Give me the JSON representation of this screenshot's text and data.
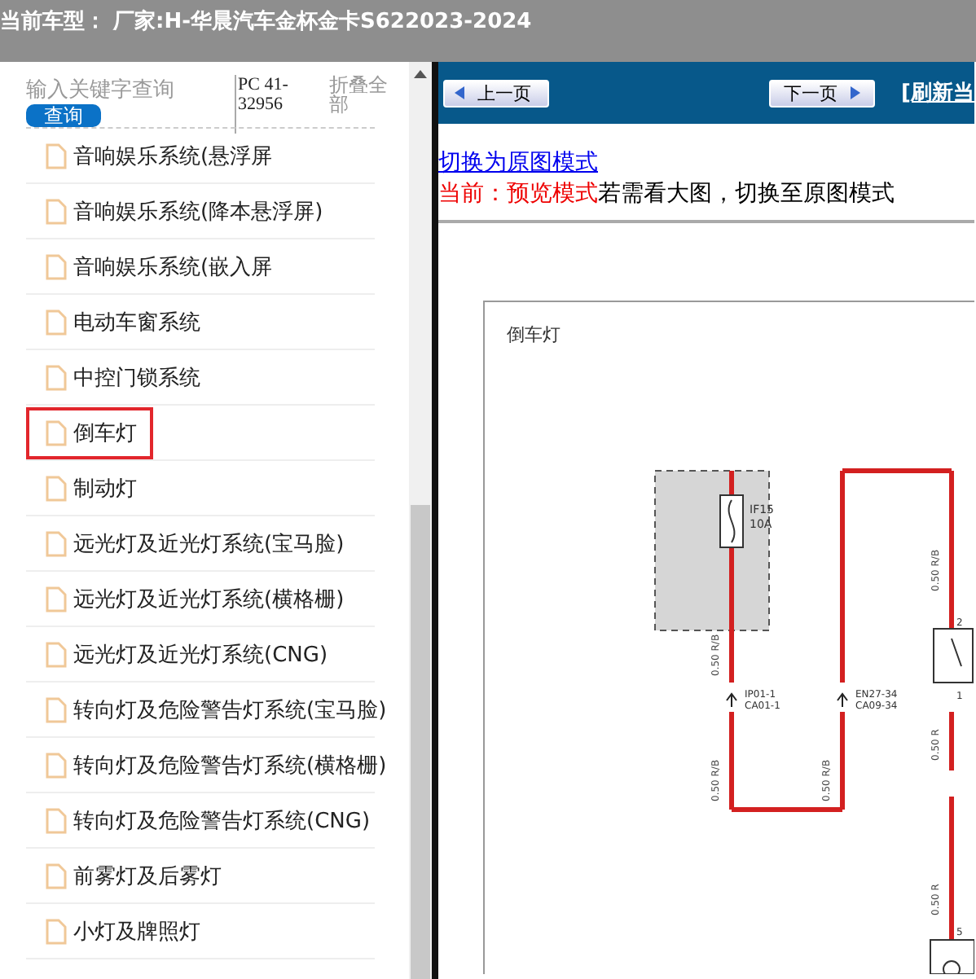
{
  "header": {
    "title": "当前车型：  厂家:H-华晨汽车金杯金卡S622023-2024"
  },
  "sidebar": {
    "search": {
      "placeholder": "输入关键字查询"
    },
    "search_button": "查询",
    "code": "PC 41-32956",
    "collapse": "折叠全部",
    "items": [
      {
        "label": "音响娱乐系统(悬浮屏",
        "selected": false
      },
      {
        "label": "音响娱乐系统(降本悬浮屏)",
        "selected": false
      },
      {
        "label": "音响娱乐系统(嵌入屏",
        "selected": false
      },
      {
        "label": "电动车窗系统",
        "selected": false
      },
      {
        "label": "中控门锁系统",
        "selected": false
      },
      {
        "label": "倒车灯",
        "selected": true
      },
      {
        "label": "制动灯",
        "selected": false
      },
      {
        "label": "远光灯及近光灯系统(宝马脸)",
        "selected": false
      },
      {
        "label": "远光灯及近光灯系统(横格栅)",
        "selected": false
      },
      {
        "label": "远光灯及近光灯系统(CNG)",
        "selected": false
      },
      {
        "label": "转向灯及危险警告灯系统(宝马脸)",
        "selected": false
      },
      {
        "label": "转向灯及危险警告灯系统(横格栅)",
        "selected": false
      },
      {
        "label": "转向灯及危险警告灯系统(CNG)",
        "selected": false
      },
      {
        "label": "前雾灯及后雾灯",
        "selected": false
      },
      {
        "label": "小灯及牌照灯",
        "selected": false
      }
    ]
  },
  "toolbar": {
    "prev_button": "上一页",
    "next_button": "下一页",
    "refresh_link": "[刷新当"
  },
  "view": {
    "switch_link": "切换为原图模式",
    "current_mode": "当前：预览模式",
    "hint": "若需看大图，切换至原图模式"
  },
  "diagram": {
    "title": "倒车灯",
    "fuse_label": "IF15",
    "fuse_rating": "10A",
    "wire_labels": [
      "0.50 R/B",
      "0.50 R/B",
      "0.50 R/B",
      "0.50 R/B",
      "0.50 R",
      "0.50 R"
    ],
    "connectors": [
      {
        "top": "IP01-1",
        "bottom": "CA01-1"
      },
      {
        "top": "EN27-34",
        "bottom": "CA09-34"
      }
    ],
    "pins": [
      "2",
      "1",
      "5"
    ]
  }
}
